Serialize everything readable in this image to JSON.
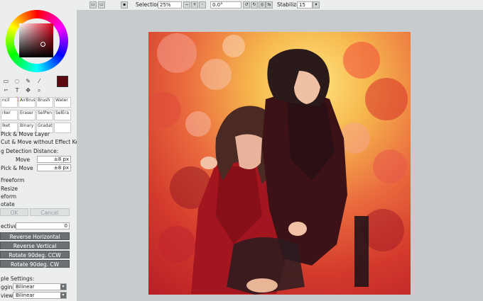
{
  "toolbar": {
    "selection_label": "Selection",
    "zoom_value": "25%",
    "rotation_value": "0.0°",
    "stabilizer_label": "Stabilizer",
    "stabilizer_value": "15"
  },
  "tools": {
    "text_tool": "T"
  },
  "brushes": [
    {
      "label": "ncil"
    },
    {
      "label": "AirBrush"
    },
    {
      "label": "Brush"
    },
    {
      "label": "Water"
    },
    {
      "label": "rker"
    },
    {
      "label": "Eraser"
    },
    {
      "label": "SelPen"
    },
    {
      "label": "SelEra"
    },
    {
      "label": "Iket"
    },
    {
      "label": "Binary"
    },
    {
      "label": "Gradation"
    },
    {
      "label": ""
    }
  ],
  "move_panel": {
    "option1": "Pick & Move Layer",
    "option2": "Cut & Move without Effect Key",
    "drag_heading": "g Detection Distance:",
    "move_label": "Move",
    "move_value": "±8 px",
    "pick_move_label": "Pick & Move",
    "pick_move_value": "±8 px"
  },
  "transform": {
    "modes": [
      "Freeform",
      "Resize",
      "eform",
      "otate"
    ],
    "ok_label": "OK",
    "cancel_label": "Cancel",
    "perspective_label": "ective",
    "perspective_value": "0",
    "reverse_horizontal": "Reverse Horizontal",
    "reverse_vertical": "Reverse Vertical",
    "rotate_ccw": "Rotate 90deg. CCW",
    "rotate_cw": "Rotate 90deg. CW"
  },
  "sample_settings": {
    "heading": "ple Settings:",
    "dragging_label": "gging",
    "dragging_value": "Bilinear",
    "preview_label": "view",
    "preview_value": "Bilinear"
  },
  "colors": {
    "current_color": "#5a0a10",
    "panel_bg": "#eceeee",
    "canvas_bg": "#c8cbcd",
    "button_gray": "#6c7073"
  }
}
